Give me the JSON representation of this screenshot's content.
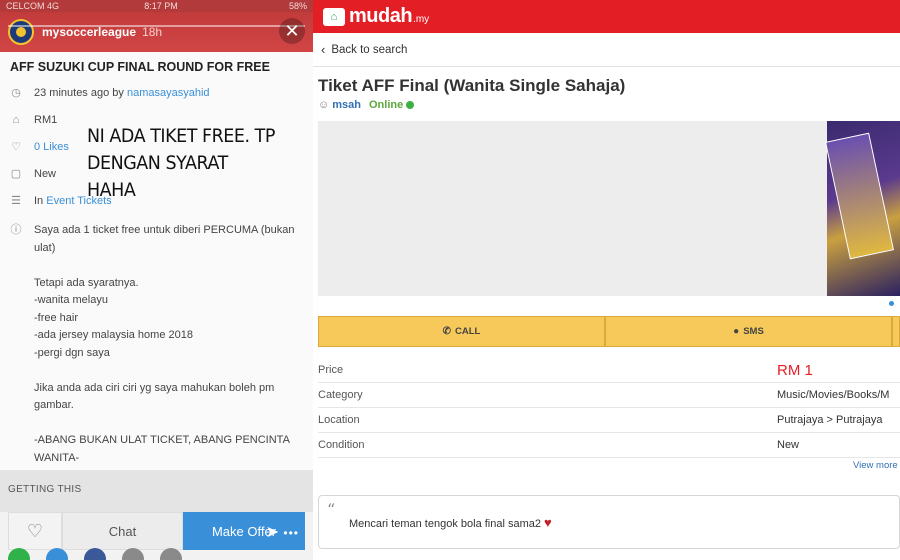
{
  "story": {
    "status": {
      "carrier": "CELCOM  4G",
      "time": "8:17 PM",
      "battery": "58%"
    },
    "username": "mysoccerleague",
    "age": "18h",
    "close_glyph": "✕",
    "overlay_line1": "NI ADA TIKET FREE. TP",
    "overlay_line2": "DENGAN SYARAT HAHA"
  },
  "listing": {
    "title": "AFF SUZUKI CUP FINAL ROUND FOR FREE",
    "posted": "23 minutes ago by",
    "author": "namasayasyahid",
    "price": "RM1",
    "likes": "0 Likes",
    "condition": "New",
    "category_prefix": "In",
    "category": "Event Tickets",
    "description": [
      "Saya ada 1 ticket free untuk diberi PERCUMA (bukan ulat)",
      "",
      "Tetapi ada syaratnya.",
      "-wanita melayu",
      "-free hair",
      "-ada jersey malaysia home 2018",
      "-pergi dgn saya",
      "",
      "Jika anda ada ciri ciri yg saya mahukan boleh pm gambar.",
      "",
      "-ABANG BUKAN ULAT TICKET, ABANG PENCINTA WANITA-"
    ],
    "getting_this": "GETTING THIS",
    "chat_label": "Chat",
    "offer_label": "Make Offer",
    "icons": [
      "clock-icon",
      "tag-icon",
      "heart-icon",
      "box-icon",
      "list-icon",
      "info-icon"
    ]
  },
  "mudah": {
    "logo": "mudah",
    "logo_tld": ".my",
    "back_label": "Back to search",
    "ad_title": "Tiket AFF Final (Wanita Single Sahaja)",
    "seller": "msah",
    "online": "Online",
    "call_label": "CALL",
    "sms_label": "SMS",
    "details": [
      {
        "key": "Price",
        "value": "RM 1"
      },
      {
        "key": "Category",
        "value": "Music/Movies/Books/M"
      },
      {
        "key": "Location",
        "value": "Putrajaya > Putrajaya"
      },
      {
        "key": "Condition",
        "value": "New"
      }
    ],
    "view_more": "View more",
    "comment": "Mencari teman tengok bola final sama2",
    "colors": {
      "brand": "#e31e24",
      "call_bar": "#f7c95a",
      "link": "#3470b5",
      "online": "#3cb043"
    }
  }
}
